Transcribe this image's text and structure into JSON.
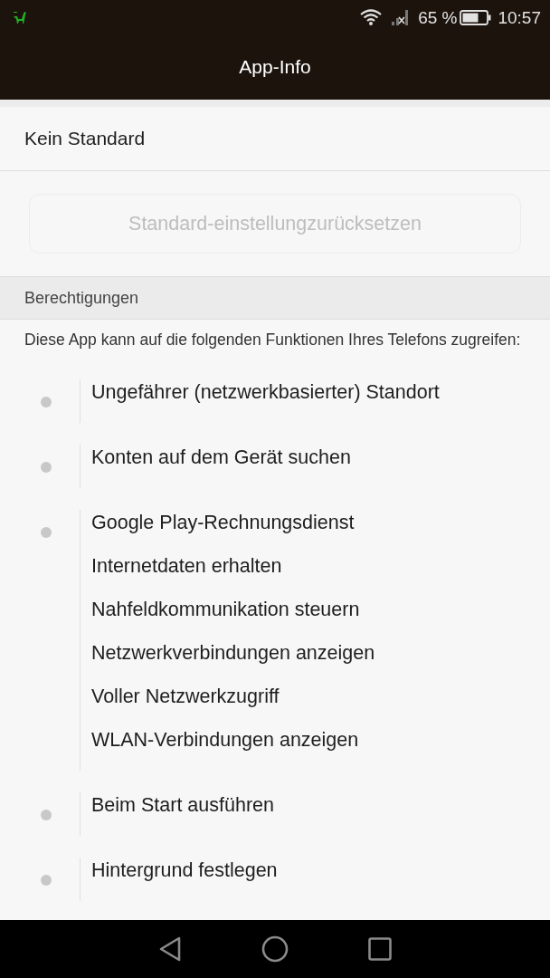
{
  "status_bar": {
    "battery": "65 %",
    "time": "10:57"
  },
  "title_bar": {
    "title": "App-Info"
  },
  "defaults": {
    "label": "Kein Standard",
    "reset_button": {
      "label": "Standard-einstellungzurücksetzen",
      "disabled": true
    }
  },
  "permissions": {
    "header": "Berechtigungen",
    "description": "Diese App kann auf die folgenden Funktionen Ihres Telefons zugreifen:",
    "groups": [
      {
        "items": [
          "Ungefährer (netzwerkbasierter) Standort"
        ]
      },
      {
        "items": [
          "Konten auf dem Gerät suchen"
        ]
      },
      {
        "items": [
          "Google Play-Rechnungsdienst",
          "Internetdaten erhalten",
          "Nahfeldkommunikation steuern",
          "Netzwerkverbindungen anzeigen",
          "Voller Netzwerkzugriff",
          "WLAN-Verbindungen anzeigen"
        ]
      },
      {
        "items": [
          "Beim Start ausführen"
        ]
      },
      {
        "items": [
          "Hintergrund festlegen"
        ]
      }
    ]
  }
}
